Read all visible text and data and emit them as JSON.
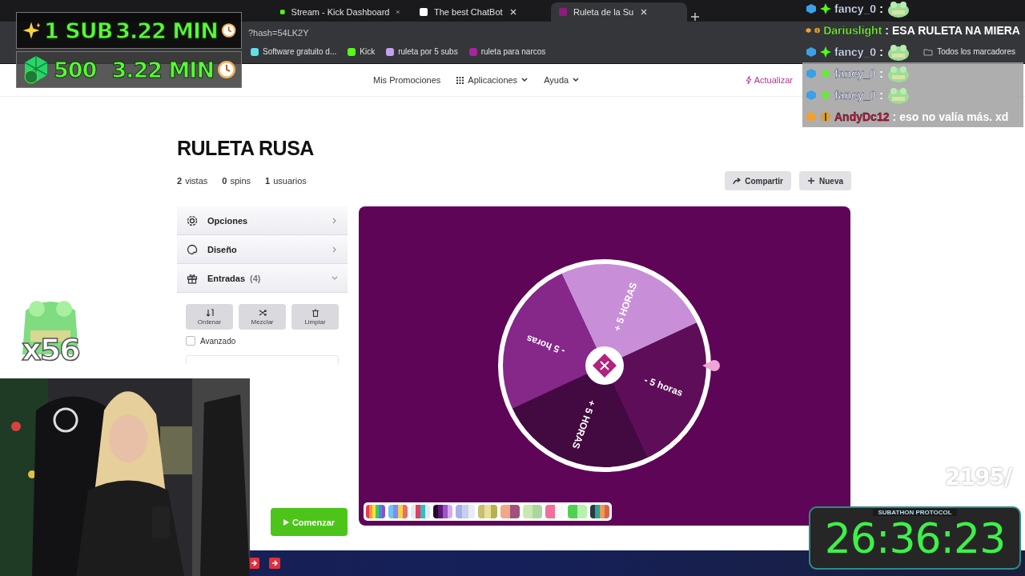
{
  "browser": {
    "tabs": [
      {
        "label": "Stream - Kick Dashboard",
        "selected": false
      },
      {
        "label": "The best ChatBot",
        "selected": false
      },
      {
        "label": "Ruleta de la Su",
        "selected": true
      }
    ],
    "address": "?hash=54LK2Y",
    "bookmarks": [
      "Software gratuito d...",
      "Kick",
      "ruleta por 5 subs",
      "ruleta para narcos"
    ],
    "all_bookmarks": "Todos los marcadores"
  },
  "nav": {
    "items": [
      {
        "label": "Mis Promociones",
        "kind": "link"
      },
      {
        "label": "Aplicaciones",
        "kind": "menu"
      },
      {
        "label": "Ayuda",
        "kind": "menu"
      }
    ],
    "update": "Actualizar"
  },
  "wheel_page": {
    "title": "RULETA RUSA",
    "stats": [
      "**2** vistas",
      "**0** spins",
      "**1** usuarios"
    ],
    "actions": [
      {
        "label": "Compartir",
        "kind": "share"
      },
      {
        "label": "Nueva",
        "kind": "new"
      }
    ],
    "sections": [
      {
        "label": "Opciones",
        "kind": "options",
        "expanded": false
      },
      {
        "label": "Diseño",
        "kind": "design",
        "expanded": false
      },
      {
        "label": "Entradas",
        "count": "(4)",
        "kind": "entries",
        "expanded": true
      }
    ],
    "tools": [
      {
        "label": "Ordenar",
        "kind": "sort"
      },
      {
        "label": "Mezclar",
        "kind": "shuffle"
      },
      {
        "label": "Limpiar",
        "kind": "clear"
      }
    ],
    "advanced": {
      "label": "Avanzado",
      "checked": false
    },
    "start": "Comenzar",
    "segments": [
      {
        "label": "+ 5 HORAS",
        "color": "#c88fd8"
      },
      {
        "label": "- 5 horas",
        "color": "#5e0e59"
      },
      {
        "label": "+ 5 HORAS",
        "color": "#420a40"
      },
      {
        "label": "- 5 horas",
        "color": "#86278a"
      }
    ]
  },
  "overlay": {
    "goals": [
      {
        "kind": "sub",
        "count": "1 SUB",
        "time": "3.22 MIN"
      },
      {
        "kind": "kicks",
        "count": "500",
        "time": "3.22 MIN"
      }
    ],
    "chat": [
      {
        "kind": "emote",
        "user": "fancy_0",
        "separator": ":",
        "color": "#dce6ff"
      },
      {
        "kind": "text",
        "user": "Dariuslight",
        "separator": ":",
        "message": "ESA RULETA NA MIERA",
        "color": "#7cf53c"
      },
      {
        "kind": "emote",
        "user": "fancy_0",
        "separator": ":",
        "color": "#dce6ff"
      },
      {
        "kind": "emote",
        "user": "fancy_0",
        "separator": ":",
        "color": "#dce6ff"
      },
      {
        "kind": "emote",
        "user": "fancy_0",
        "separator": ":",
        "color": "#dce6ff"
      },
      {
        "kind": "text",
        "user": "AndyDc12",
        "separator": ":",
        "message": "eso no valía más. xd",
        "color": "#c0183c"
      }
    ],
    "multiplier": "x56",
    "goal_progress": "2195/",
    "timer": {
      "header": "SUBATHON PROTOCOL",
      "time": "26:36:23"
    }
  }
}
